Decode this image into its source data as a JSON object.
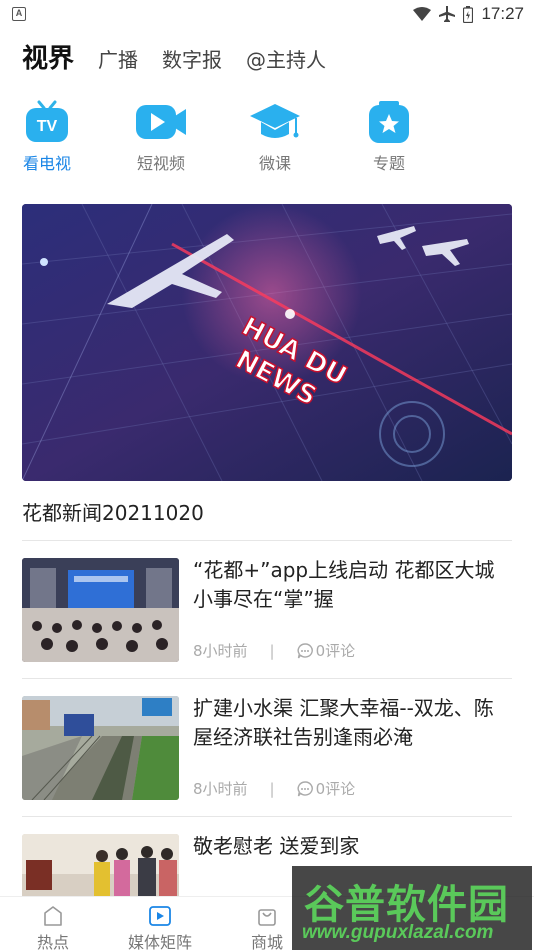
{
  "status": {
    "time": "17:27",
    "left_badge": "A"
  },
  "topnav": {
    "active": "视界",
    "items": [
      "广播",
      "数字报",
      "@主持人"
    ]
  },
  "categories": [
    {
      "label": "看电视",
      "icon": "tv-icon",
      "active": true
    },
    {
      "label": "短视频",
      "icon": "play-video-icon",
      "active": false
    },
    {
      "label": "微课",
      "icon": "graduation-cap-icon",
      "active": false
    },
    {
      "label": "专题",
      "icon": "star-icon",
      "active": false
    }
  ],
  "hero": {
    "caption": "花都新闻20211020",
    "overlay_text": [
      "HUA DU",
      "NEWS"
    ]
  },
  "news": [
    {
      "title": "“花都+”app上线启动 花都区大城小事尽在“掌”握",
      "time": "8小时前",
      "comments": "0评论"
    },
    {
      "title": "扩建小水渠 汇聚大幸福--双龙、陈屋经济联社告别逢雨必淹",
      "time": "8小时前",
      "comments": "0评论"
    },
    {
      "title": "敬老慰老 送爱到家",
      "time": "",
      "comments": ""
    }
  ],
  "meta_separator": "|",
  "tabbar": [
    {
      "label": "热点",
      "icon": "hot-icon"
    },
    {
      "label": "媒体矩阵",
      "icon": "media-play-icon"
    },
    {
      "label": "商城",
      "icon": "shopping-bag-icon"
    }
  ],
  "watermark": {
    "text": "谷普软件园",
    "url": "www.gupuxlazal.com"
  },
  "colors": {
    "accent": "#1b86e6",
    "watermark_green": "#5ac95a"
  }
}
